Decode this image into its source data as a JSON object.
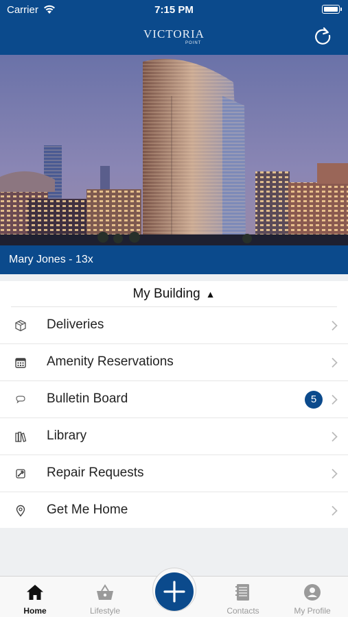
{
  "status_bar": {
    "carrier": "Carrier",
    "time": "7:15 PM"
  },
  "header": {
    "logo_text": "VICTORIA",
    "logo_sub": "POINT",
    "brand_color": "#0b4a8c"
  },
  "resident": {
    "banner": "Mary Jones - 13x"
  },
  "section": {
    "title": "My Building",
    "caret": "▲"
  },
  "menu": [
    {
      "label": "Deliveries",
      "icon": "package-icon"
    },
    {
      "label": "Amenity Reservations",
      "icon": "calendar-icon"
    },
    {
      "label": "Bulletin Board",
      "icon": "chat-bubble-icon",
      "badge": "5"
    },
    {
      "label": "Library",
      "icon": "books-icon"
    },
    {
      "label": "Repair Requests",
      "icon": "wrench-icon"
    },
    {
      "label": "Get Me Home",
      "icon": "location-pin-icon"
    }
  ],
  "tabs": [
    {
      "label": "Home",
      "icon": "home-icon",
      "active": true
    },
    {
      "label": "Lifestyle",
      "icon": "basket-icon"
    },
    {
      "label": "",
      "icon": "plus-icon"
    },
    {
      "label": "Contacts",
      "icon": "address-book-icon"
    },
    {
      "label": "My Profile",
      "icon": "profile-icon"
    }
  ]
}
